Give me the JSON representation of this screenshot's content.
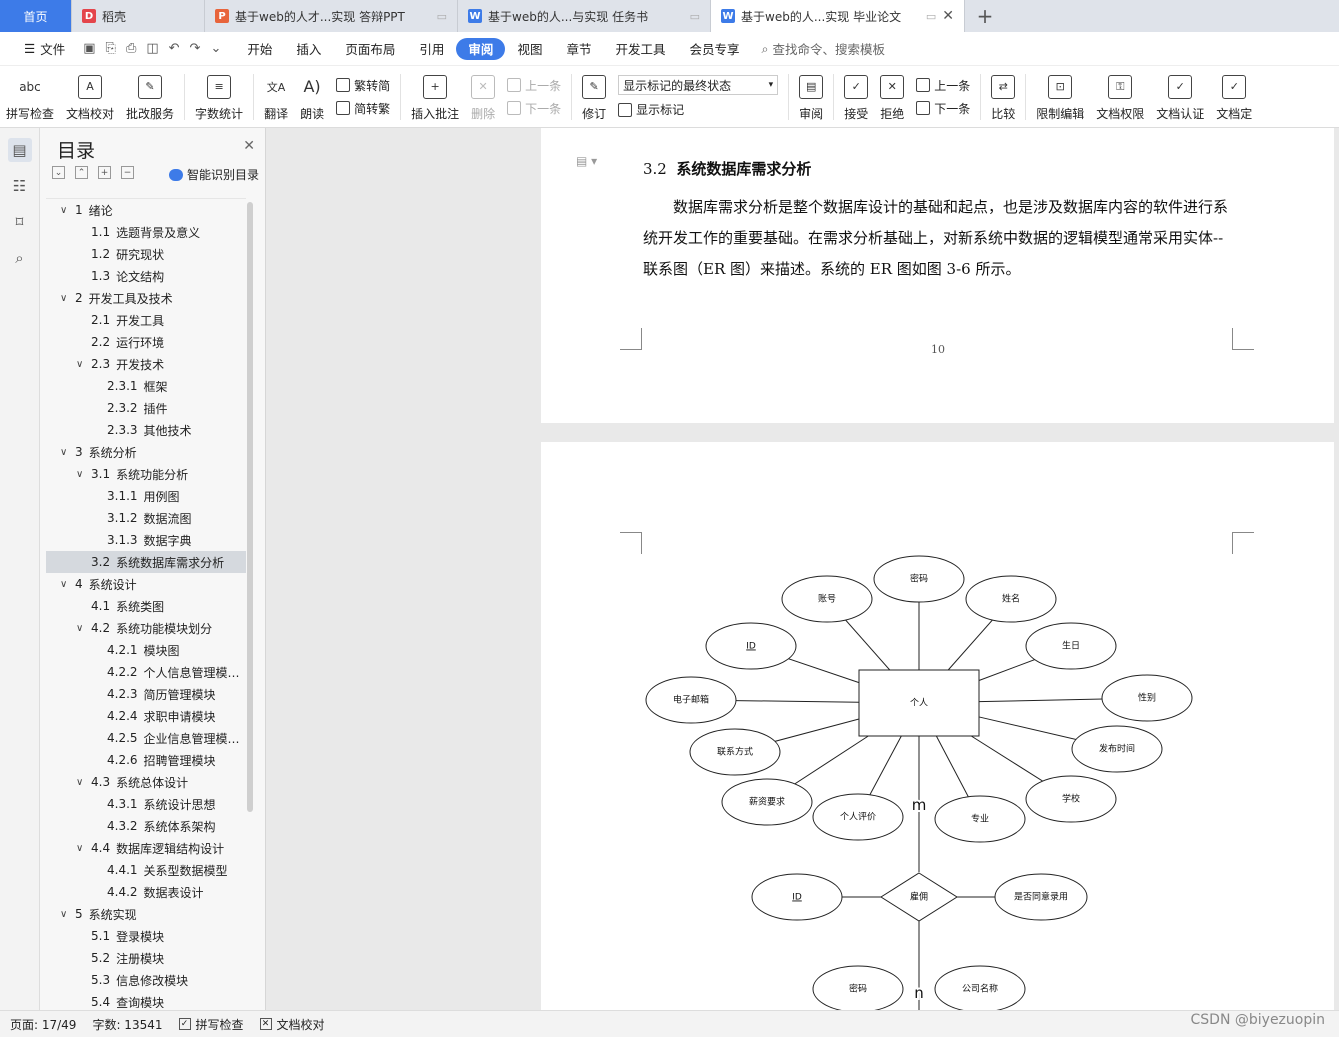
{
  "tabs": [
    {
      "label": "首页",
      "icon": ""
    },
    {
      "label": "稻壳",
      "icon": "docer-icon"
    },
    {
      "label": "基于web的人才...实现 答辩PPT",
      "icon": "ppt-icon"
    },
    {
      "label": "基于web的人...与实现 任务书",
      "icon": "word-icon"
    },
    {
      "label": "基于web的人...实现 毕业论文",
      "icon": "word-icon"
    }
  ],
  "menu": {
    "file": "文件",
    "items": [
      "开始",
      "插入",
      "页面布局",
      "引用",
      "审阅",
      "视图",
      "章节",
      "开发工具",
      "会员专享"
    ],
    "active": "审阅",
    "search": "查找命令、搜索模板"
  },
  "ribbon": {
    "spellcheck": "拼写检查",
    "proofread": "文档校对",
    "batch": "批改服务",
    "wordcount": "字数统计",
    "translate": "翻译",
    "read": "朗读",
    "trad": "繁转简",
    "simp": "简转繁",
    "insert_comment": "插入批注",
    "delete": "删除",
    "prev": "上一条",
    "next": "下一条",
    "revise": "修订",
    "markup_state": "显示标记的最终状态",
    "show_markup": "显示标记",
    "review": "审阅",
    "accept": "接受",
    "reject": "拒绝",
    "prev2": "上一条",
    "next2": "下一条",
    "compare": "比较",
    "restrict": "限制编辑",
    "permission": "文档权限",
    "certify": "文档认证",
    "more": "文档定"
  },
  "toc": {
    "title": "目录",
    "smart": "智能识别目录",
    "items": [
      {
        "level": 1,
        "num": "1",
        "text": "绪论"
      },
      {
        "level": 2,
        "num": "1.1",
        "text": "选题背景及意义"
      },
      {
        "level": 2,
        "num": "1.2",
        "text": "研究现状"
      },
      {
        "level": 2,
        "num": "1.3",
        "text": "论文结构"
      },
      {
        "level": 1,
        "num": "2",
        "text": "开发工具及技术"
      },
      {
        "level": 2,
        "num": "2.1",
        "text": "开发工具"
      },
      {
        "level": 2,
        "num": "2.2",
        "text": "运行环境"
      },
      {
        "level": 2,
        "num": "2.3",
        "text": "开发技术",
        "expand": true
      },
      {
        "level": 3,
        "num": "2.3.1",
        "text": "框架"
      },
      {
        "level": 3,
        "num": "2.3.2",
        "text": "插件"
      },
      {
        "level": 3,
        "num": "2.3.3",
        "text": "其他技术"
      },
      {
        "level": 1,
        "num": "3",
        "text": "系统分析"
      },
      {
        "level": 2,
        "num": "3.1",
        "text": "系统功能分析",
        "expand": true
      },
      {
        "level": 3,
        "num": "3.1.1",
        "text": "用例图"
      },
      {
        "level": 3,
        "num": "3.1.2",
        "text": "数据流图"
      },
      {
        "level": 3,
        "num": "3.1.3",
        "text": "数据字典"
      },
      {
        "level": 2,
        "num": "3.2",
        "text": "系统数据库需求分析",
        "selected": true
      },
      {
        "level": 1,
        "num": "4",
        "text": "系统设计"
      },
      {
        "level": 2,
        "num": "4.1",
        "text": "系统类图"
      },
      {
        "level": 2,
        "num": "4.2",
        "text": "系统功能模块划分",
        "expand": true
      },
      {
        "level": 3,
        "num": "4.2.1",
        "text": "模块图"
      },
      {
        "level": 3,
        "num": "4.2.2",
        "text": "个人信息管理模…"
      },
      {
        "level": 3,
        "num": "4.2.3",
        "text": "简历管理模块"
      },
      {
        "level": 3,
        "num": "4.2.4",
        "text": "求职申请模块"
      },
      {
        "level": 3,
        "num": "4.2.5",
        "text": "企业信息管理模…"
      },
      {
        "level": 3,
        "num": "4.2.6",
        "text": "招聘管理模块"
      },
      {
        "level": 2,
        "num": "4.3",
        "text": "系统总体设计",
        "expand": true
      },
      {
        "level": 3,
        "num": "4.3.1",
        "text": "系统设计思想"
      },
      {
        "level": 3,
        "num": "4.3.2",
        "text": "系统体系架构"
      },
      {
        "level": 2,
        "num": "4.4",
        "text": "数据库逻辑结构设计",
        "expand": true
      },
      {
        "level": 3,
        "num": "4.4.1",
        "text": "关系型数据模型"
      },
      {
        "level": 3,
        "num": "4.4.2",
        "text": "数据表设计"
      },
      {
        "level": 1,
        "num": "5",
        "text": "系统实现"
      },
      {
        "level": 2,
        "num": "5.1",
        "text": "登录模块"
      },
      {
        "level": 2,
        "num": "5.2",
        "text": "注册模块"
      },
      {
        "level": 2,
        "num": "5.3",
        "text": "信息修改模块"
      },
      {
        "level": 2,
        "num": "5.4",
        "text": "查询模块"
      }
    ]
  },
  "document": {
    "section_num": "3.2",
    "section_title": "系统数据库需求分析",
    "paragraph": "数据库需求分析是整个数据库设计的基础和起点，也是涉及数据库内容的软件进行系统开发工作的重要基础。在需求分析基础上，对新系统中数据的逻辑模型通常采用实体--联系图（ER 图）来描述。系统的 ER 图如图 3-6 所示。",
    "page_number": "10"
  },
  "er_diagram": {
    "entity": "个人",
    "attributes": [
      "密码",
      "账号",
      "姓名",
      "ID",
      "生日",
      "电子邮箱",
      "性别",
      "联系方式",
      "发布时间",
      "薪资要求",
      "学校",
      "个人评价",
      "专业"
    ],
    "relationship": "雇佣",
    "rel_attributes": [
      "ID",
      "是否同意录用"
    ],
    "card_m": "m",
    "card_n": "n",
    "lower_attributes": [
      "密码",
      "公司名称"
    ]
  },
  "status": {
    "page": "页面: 17/49",
    "words": "字数: 13541",
    "spell": "拼写检查",
    "proof": "文档校对"
  },
  "watermark": "CSDN @biyezuopin"
}
